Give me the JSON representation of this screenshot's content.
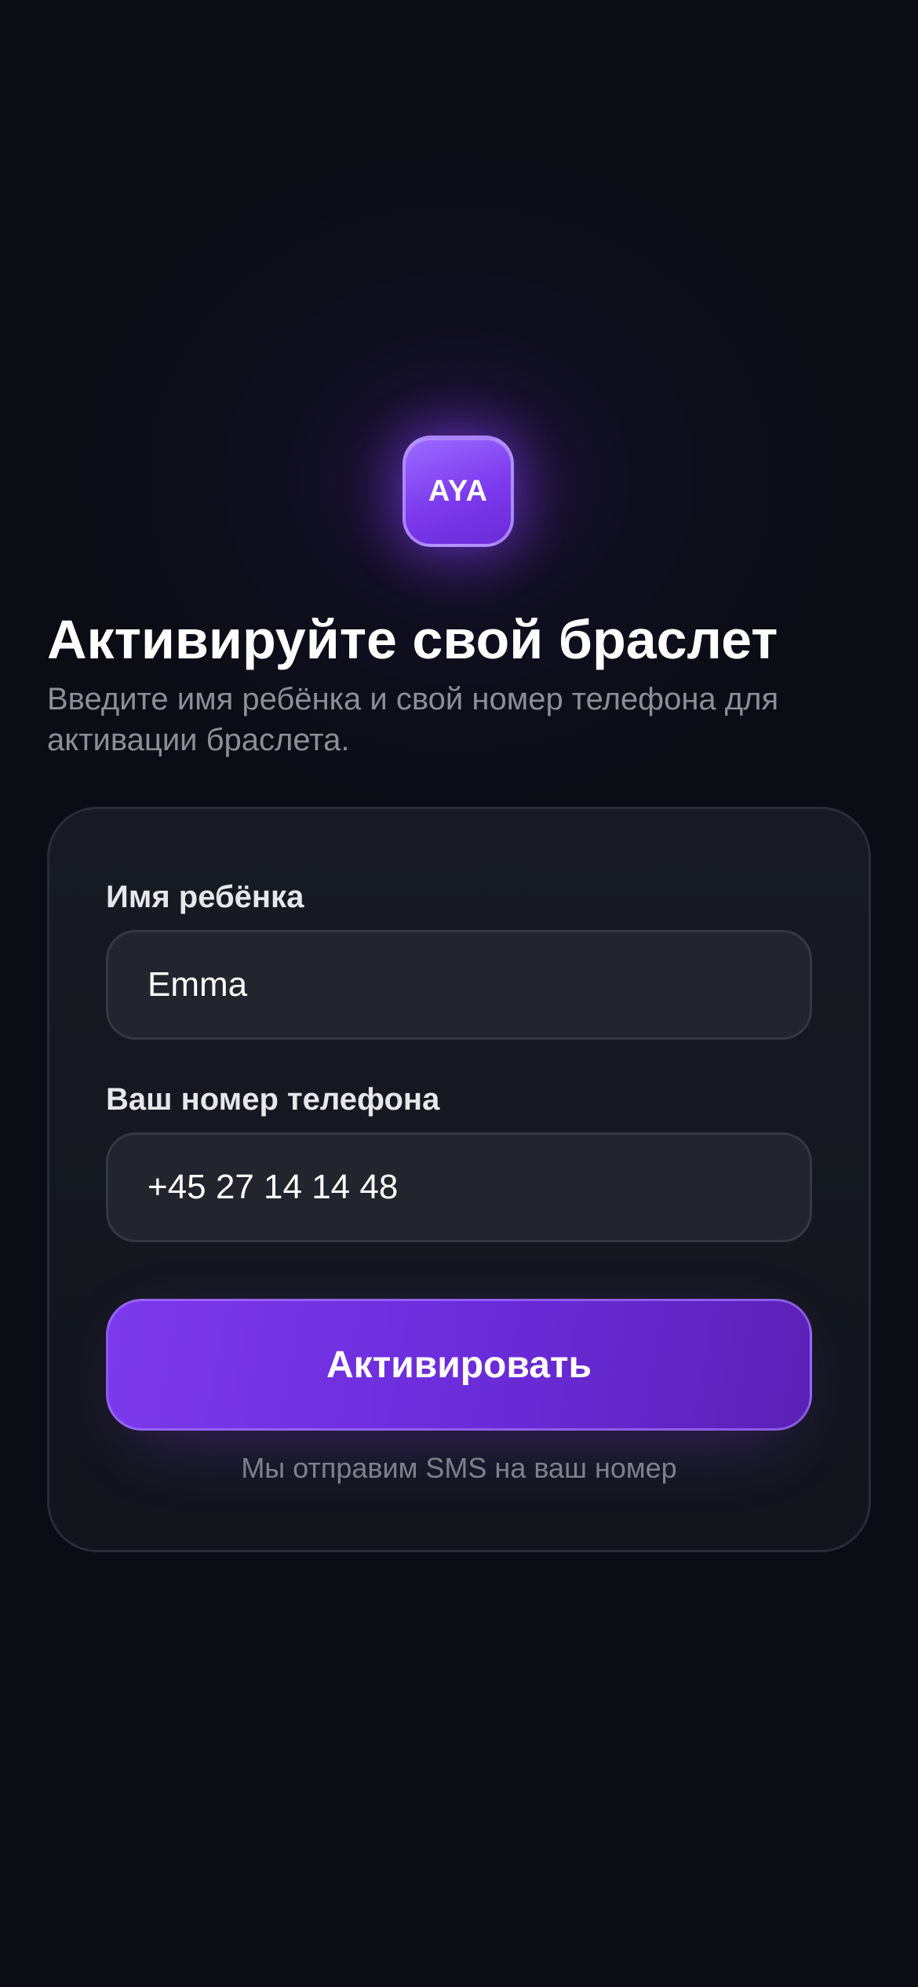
{
  "logo": {
    "text": "AYA",
    "accent_color": "#7c3aed"
  },
  "header": {
    "title": "Активируйте свой браслет",
    "subtitle": "Введите имя ребёнка и свой номер телефона для активации браслета."
  },
  "form": {
    "child_name": {
      "label": "Имя ребёнка",
      "value": "Emma"
    },
    "phone": {
      "label": "Ваш номер телефона",
      "value": "+45 27 14 14 48"
    },
    "submit_label": "Активировать",
    "hint": "Мы отправим SMS на ваш номер"
  },
  "colors": {
    "background": "#0a0d14",
    "card": "#171a22",
    "input": "#22252d",
    "accent": "#7c3aed",
    "muted_text": "#8c8f99"
  }
}
